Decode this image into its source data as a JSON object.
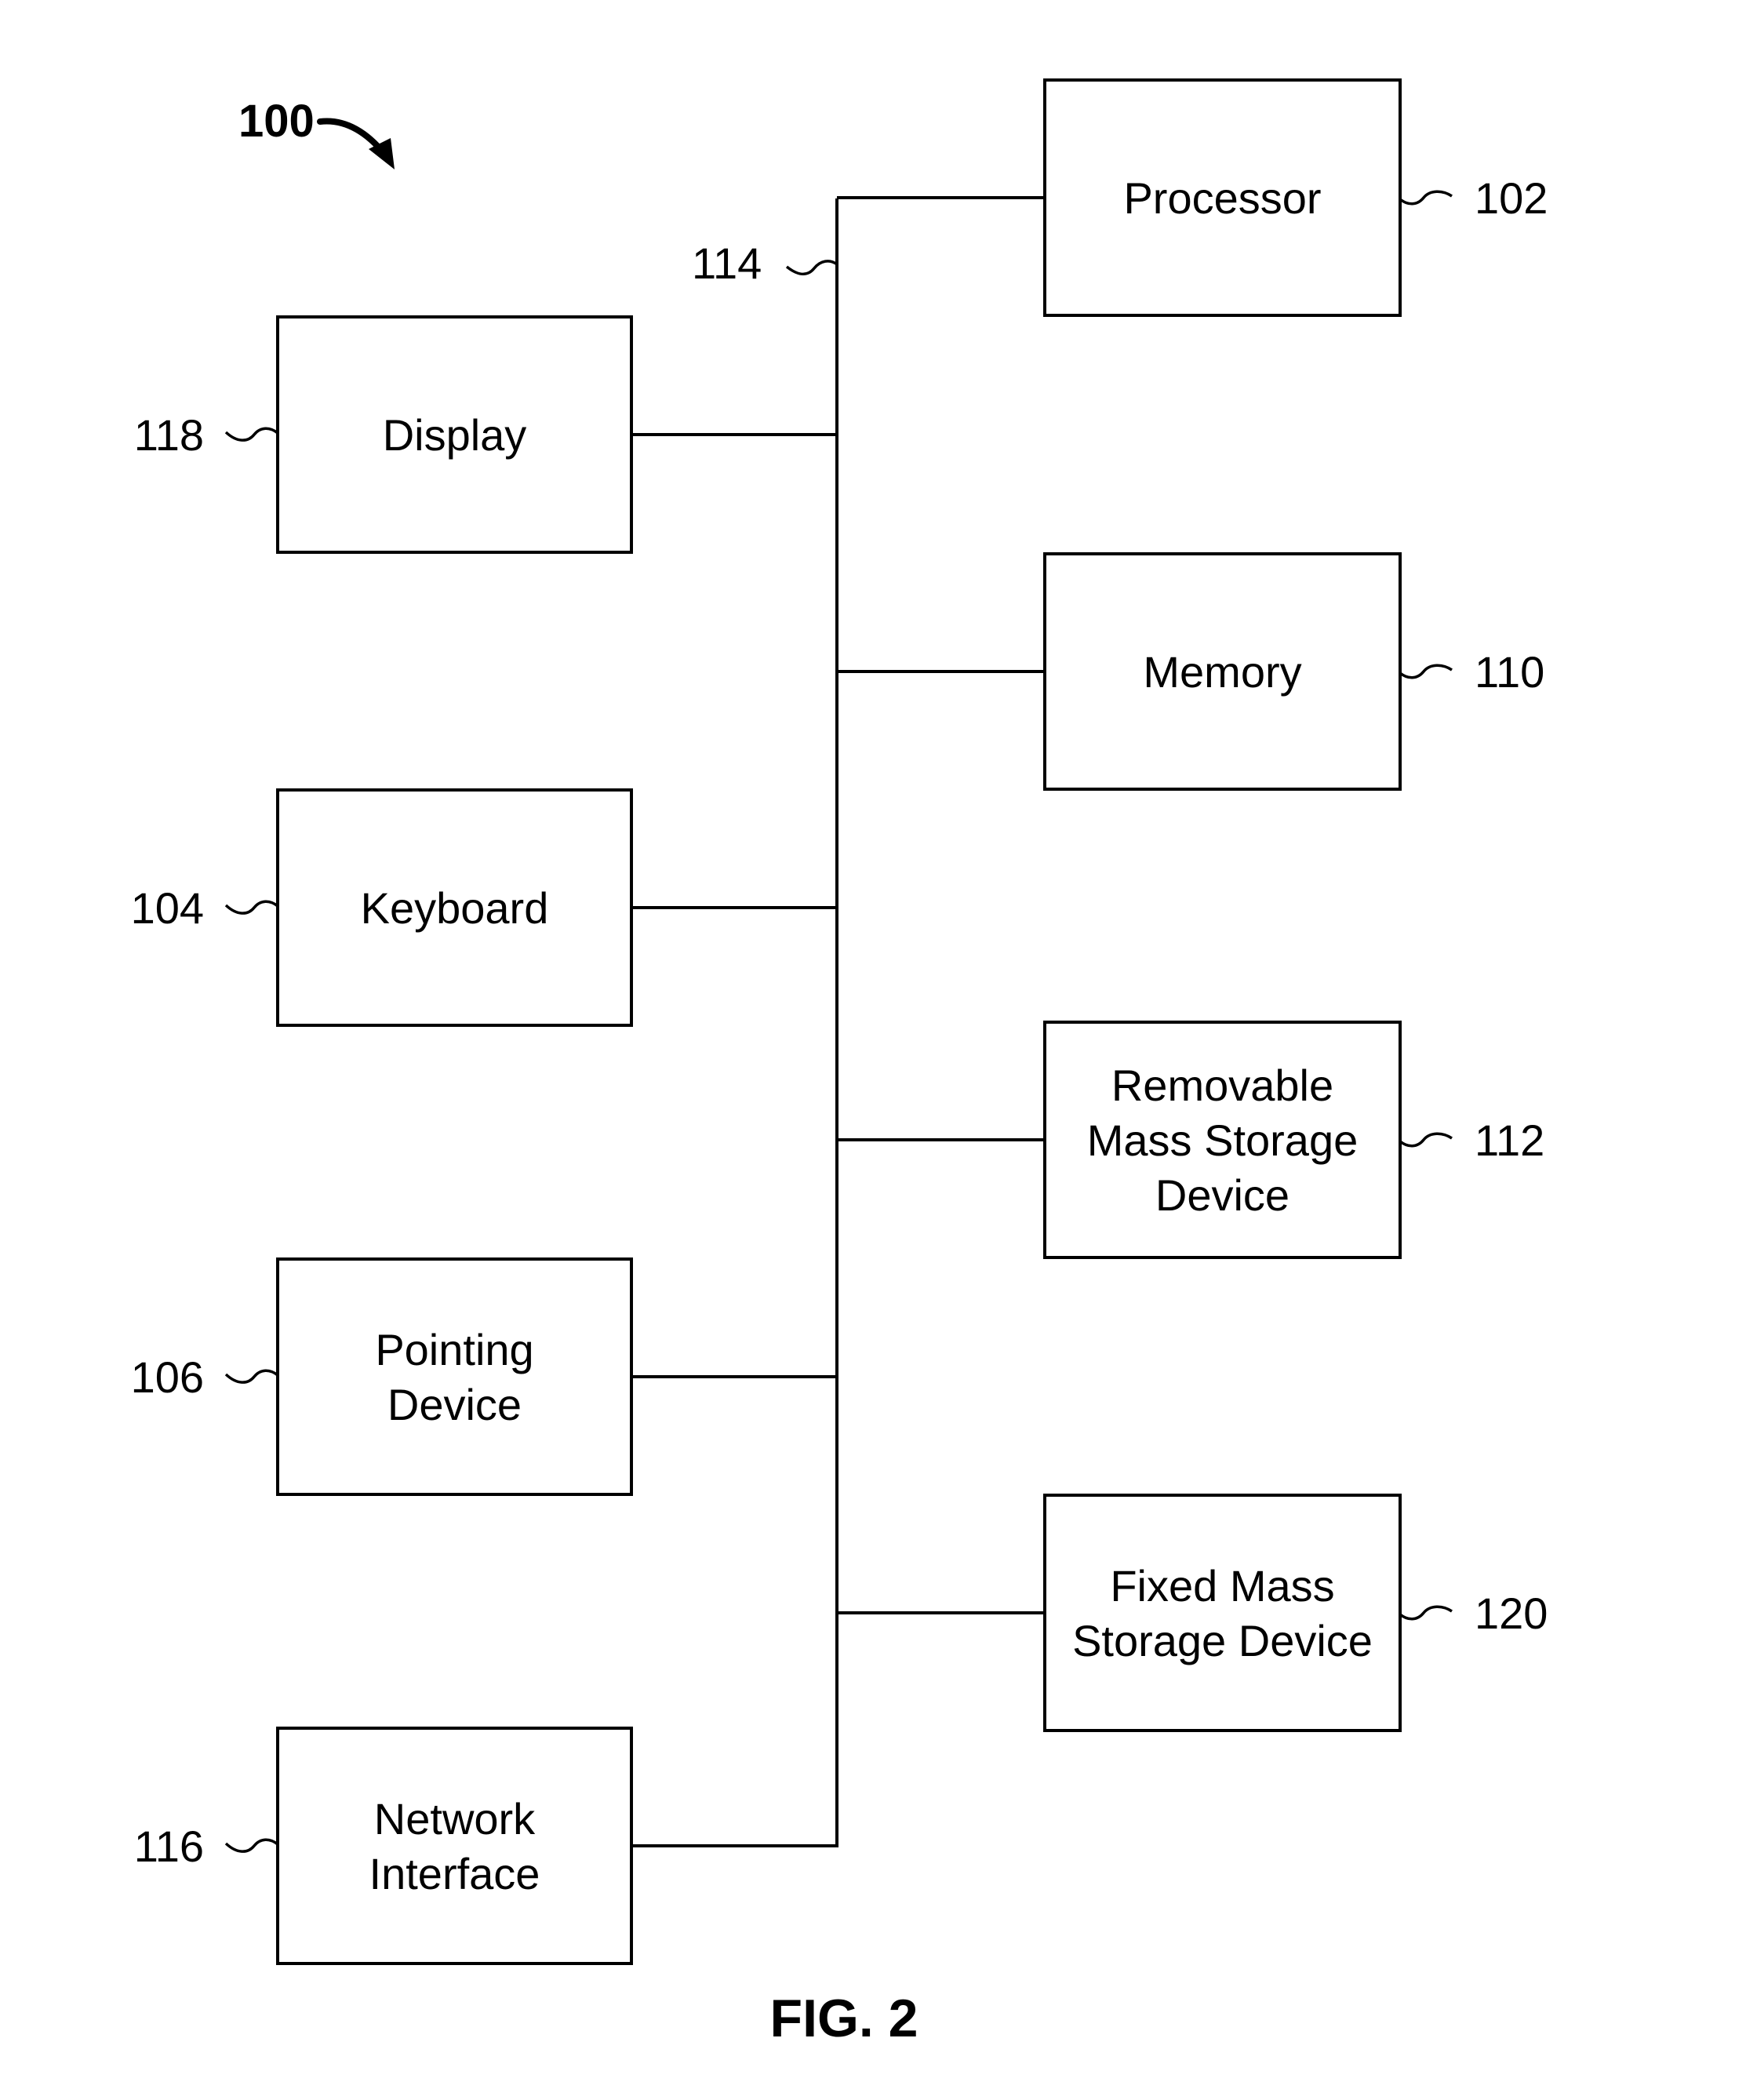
{
  "figure": {
    "title": "FIG. 2",
    "system_ref": "100",
    "bus_ref": "114"
  },
  "left_column": [
    {
      "ref": "118",
      "lines": [
        "Display"
      ]
    },
    {
      "ref": "104",
      "lines": [
        "Keyboard"
      ]
    },
    {
      "ref": "106",
      "lines": [
        "Pointing",
        "Device"
      ]
    },
    {
      "ref": "116",
      "lines": [
        "Network",
        "Interface"
      ]
    }
  ],
  "right_column": [
    {
      "ref": "102",
      "lines": [
        "Processor"
      ]
    },
    {
      "ref": "110",
      "lines": [
        "Memory"
      ]
    },
    {
      "ref": "112",
      "lines": [
        "Removable",
        "Mass Storage",
        "Device"
      ]
    },
    {
      "ref": "120",
      "lines": [
        "Fixed Mass",
        "Storage Device"
      ]
    }
  ],
  "colors": {
    "line": "#000000",
    "background": "#ffffff"
  }
}
